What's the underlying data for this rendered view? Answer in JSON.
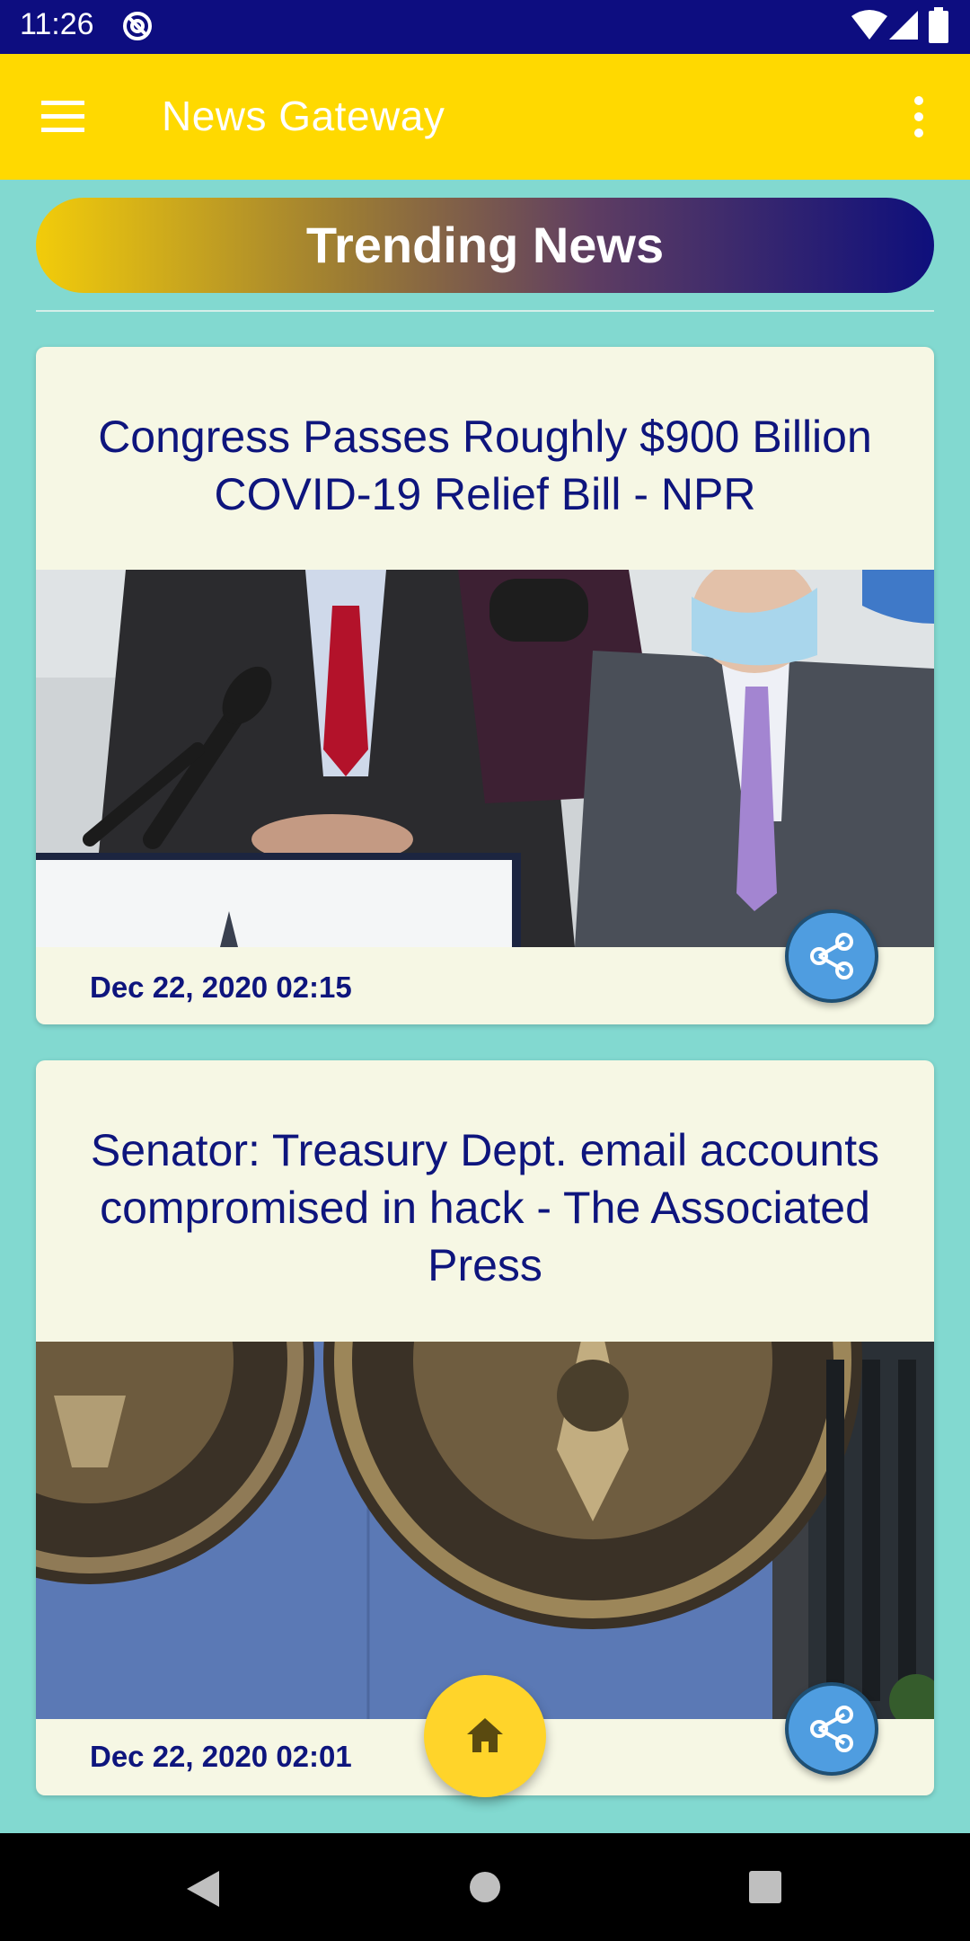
{
  "status_bar": {
    "time": "11:26"
  },
  "app_bar": {
    "title": "News Gateway",
    "menu_icon": "menu-icon",
    "overflow_icon": "more-vert-icon"
  },
  "section": {
    "title": "Trending News"
  },
  "articles": [
    {
      "headline": "Congress Passes Roughly $900 Billion COVID-19 Relief Bill - NPR",
      "date": "Dec 22, 2020 02:15"
    },
    {
      "headline": "Senator: Treasury Dept. email accounts compromised in hack - The Associated Press",
      "date": "Dec 22, 2020 02:01"
    }
  ],
  "fab": {
    "icon": "home-icon"
  },
  "colors": {
    "status_bar": "#0d0d80",
    "app_bar": "#ffd900",
    "background": "#82d9d0",
    "card": "#f6f7e4",
    "headline": "#0e157d",
    "share_button": "#4f9de0",
    "home_fab": "#ffd42a"
  }
}
